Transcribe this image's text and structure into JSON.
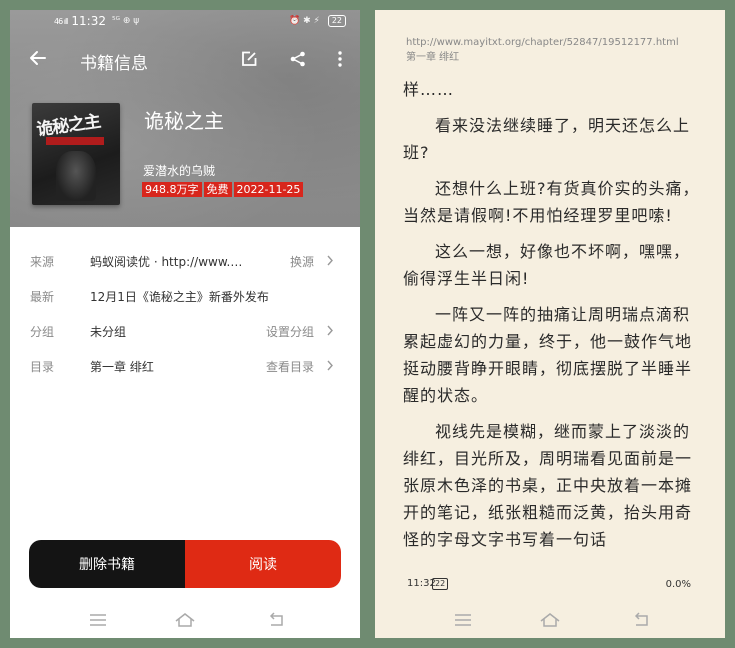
{
  "colors": {
    "accent_red": "#df2a14",
    "tag_red": "#d8261c",
    "delete_black": "#141414",
    "reader_bg": "#f6efe0",
    "background": "#6f8b71"
  },
  "status_bar": {
    "signal": "46 ıll",
    "time": "11:32",
    "icons": "⁵ᴳ ⊕ ψ",
    "right_icons": "⏰ ✱ ⚡",
    "battery": "22"
  },
  "book_info": {
    "title": "书籍信息",
    "icons": [
      "back-arrow-icon",
      "edit-icon",
      "share-icon",
      "more-icon"
    ],
    "cover_title": "诡秘之主",
    "book_name": "诡秘之主",
    "author": "爱潜水的乌贼",
    "tags": [
      "948.8万字",
      "免费",
      "2022-11-25"
    ],
    "rows": [
      {
        "label": "来源",
        "value": "蚂蚁阅读优 · http://www.…",
        "action": "换源"
      },
      {
        "label": "最新",
        "value": "12月1日《诡秘之主》新番外发布",
        "action": ""
      },
      {
        "label": "分组",
        "value": "未分组",
        "action": "设置分组"
      },
      {
        "label": "目录",
        "value": "第一章 绯红",
        "action": "查看目录"
      }
    ],
    "delete_label": "删除书籍",
    "read_label": "阅读"
  },
  "reader": {
    "url": "http://www.mayitxt.org/chapter/52847/19512177.html",
    "chapter": "第一章 绯红",
    "paragraphs": [
      "样……",
      "看来没法继续睡了，明天还怎么上班?",
      "还想什么上班?有货真价实的头痛，当然是请假啊!不用怕经理罗里吧嗦!",
      "这么一想，好像也不坏啊，嘿嘿，偷得浮生半日闲!",
      "一阵又一阵的抽痛让周明瑞点滴积累起虚幻的力量，终于，他一鼓作气地挺动腰背睁开眼睛，彻底摆脱了半睡半醒的状态。",
      "视线先是模糊，继而蒙上了淡淡的绯红，目光所及，周明瑞看见面前是一张原木色泽的书桌，正中央放着一本摊开的笔记，纸张粗糙而泛黄，抬头用奇怪的字母文字书写着一句话"
    ],
    "footer_time": "11:32",
    "footer_battery": "22",
    "progress": "0.0%"
  }
}
